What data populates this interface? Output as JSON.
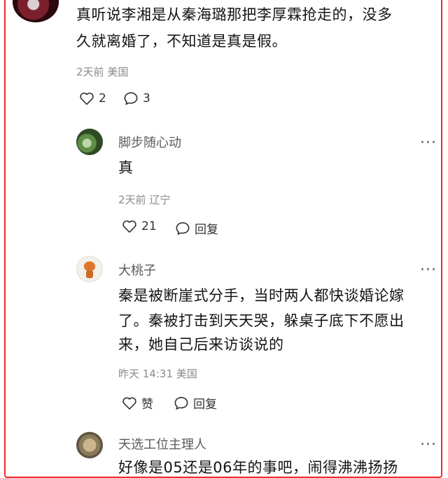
{
  "top_comment": {
    "text_line1": "真听说李湘是从秦海璐那把李厚霖抢走的，没多",
    "text_line2": "久就离婚了，不知道是真是假。",
    "time": "2天前",
    "location": "美国",
    "likes": "2",
    "replies": "3"
  },
  "replies": [
    {
      "username": "脚步随心动",
      "text": "真",
      "time": "2天前",
      "location": "辽宁",
      "likes": "21",
      "reply_label": "回复",
      "more": "···"
    },
    {
      "username": "大桃子",
      "text_line1": "秦是被断崖式分手，当时两人都快谈婚论嫁",
      "text_line2": "了。秦被打击到天天哭，躲桌子底下不愿出",
      "text_line3": "来，她自己后来访谈说的",
      "time": "昨天 14:31",
      "location": "美国",
      "like_label": "赞",
      "reply_label": "回复",
      "more": "···"
    },
    {
      "username": "天选工位主理人",
      "text_partial": "好像是05还是06年的事吧，闹得沸沸扬扬",
      "more": "···"
    }
  ],
  "icons": [
    "heart-icon",
    "comment-bubble-icon"
  ]
}
